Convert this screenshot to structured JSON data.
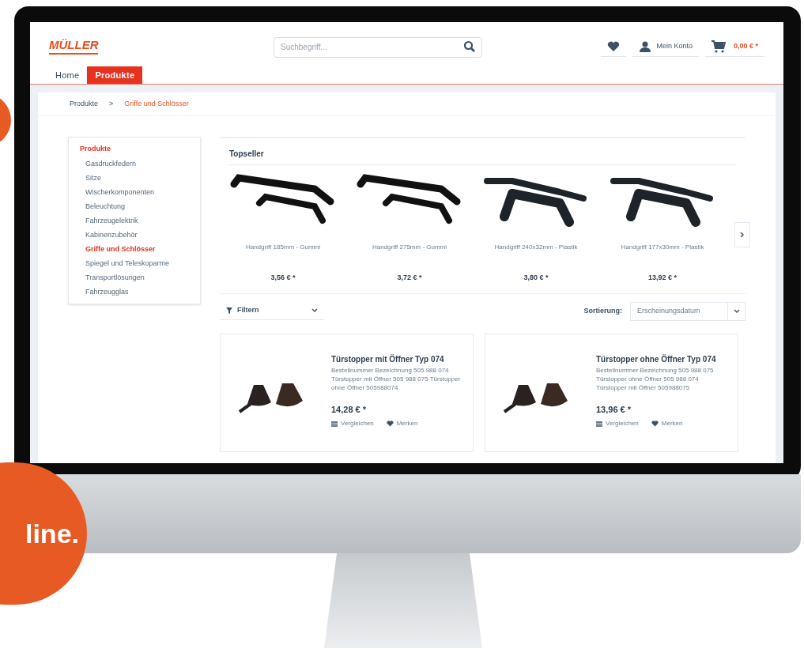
{
  "header": {
    "logo": "MÜLLER",
    "search": {
      "placeholder": "Suchbegriff..."
    },
    "account": "Mein Konto",
    "cart_total": "0,00 € *"
  },
  "nav_tabs": [
    {
      "label": "Home",
      "selected": false
    },
    {
      "label": "Produkte",
      "selected": true
    }
  ],
  "breadcrumb_separator": ">",
  "breadcrumb": [
    {
      "label": "Produkte",
      "selected": false
    },
    {
      "label": "Griffe und Schlösser",
      "selected": true
    }
  ],
  "sidebar": {
    "heading": "Produkte",
    "items": [
      {
        "label": "Gasdruckfedern",
        "selected": false
      },
      {
        "label": "Sitze",
        "selected": false
      },
      {
        "label": "Wischerkomponenten",
        "selected": false
      },
      {
        "label": "Beleuchtung",
        "selected": false
      },
      {
        "label": "Fahrzeugelektrik",
        "selected": false
      },
      {
        "label": "Kabinenzubehör",
        "selected": false
      },
      {
        "label": "Griffe und Schlösser",
        "selected": true
      },
      {
        "label": "Spiegel und Teleskoparme",
        "selected": false
      },
      {
        "label": "Transportlösungen",
        "selected": false
      },
      {
        "label": "Fahrzeugglas",
        "selected": false
      }
    ]
  },
  "topseller": {
    "title": "Topseller",
    "products": [
      {
        "name": "Handgriff 185mm - Gummi",
        "price": "3,56 € *",
        "kind": "rubber"
      },
      {
        "name": "Handgriff 275mm - Gummi",
        "price": "3,72 € *",
        "kind": "rubber"
      },
      {
        "name": "Handgriff 240x32mm - Plastik",
        "price": "3,80 € *",
        "kind": "plastic"
      },
      {
        "name": "Handgriff 177x30mm - Plastik",
        "price": "13,92 € *",
        "kind": "plastic"
      }
    ]
  },
  "filter": {
    "label": "Filtern"
  },
  "sorting": {
    "label": "Sortierung:",
    "value": "Erscheinungsdatum"
  },
  "listing": [
    {
      "title": "Türstopper mit Öffner Typ 074",
      "description": "Bestellnummer Bezeichnung 505 988 074 Türstopper mit Öffner 505 988 075 Türstopper ohne Öffner 505988074",
      "price": "14,28 € *",
      "actions": [
        "Vergleichen",
        "Merken"
      ]
    },
    {
      "title": "Türstopper ohne Öffner Typ 074",
      "description": "Bestellnummer Bezeichnung 505 988 075 Türstopper ohne Öffner 505 988 074 Türstopper mit Öffner 505988075",
      "price": "13,96 € *",
      "actions": [
        "Vergleichen",
        "Merken"
      ]
    }
  ],
  "badge": "line."
}
